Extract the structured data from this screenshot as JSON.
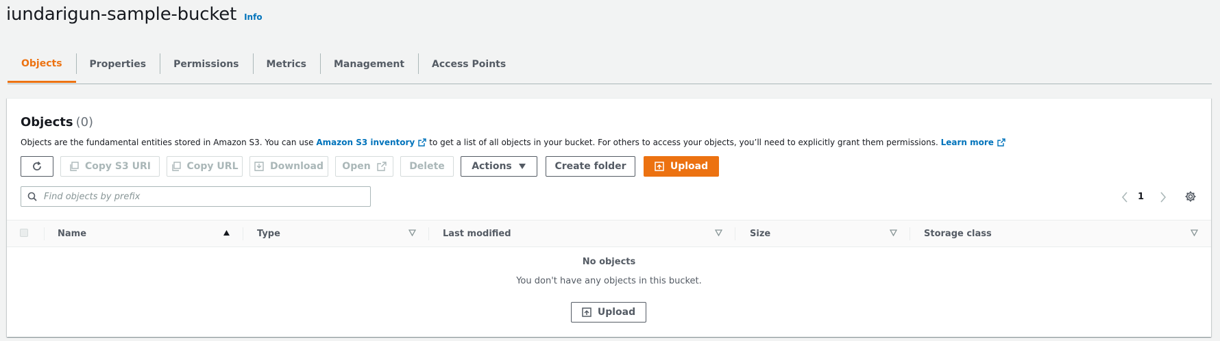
{
  "header": {
    "title": "iundarigun-sample-bucket",
    "info_label": "Info"
  },
  "tabs": [
    {
      "label": "Objects",
      "active": true
    },
    {
      "label": "Properties"
    },
    {
      "label": "Permissions"
    },
    {
      "label": "Metrics"
    },
    {
      "label": "Management"
    },
    {
      "label": "Access Points"
    }
  ],
  "objects": {
    "heading": "Objects",
    "count": "(0)",
    "desc_part1": "Objects are the fundamental entities stored in Amazon S3. You can use",
    "inventory_link": "Amazon S3 inventory",
    "desc_part2": "to get a list of all objects in your bucket. For others to access your objects, you’ll need to explicitly grant them permissions.",
    "learn_more": "Learn more"
  },
  "toolbar": {
    "copy_s3_uri": "Copy S3 URI",
    "copy_url": "Copy URL",
    "download": "Download",
    "open": "Open",
    "delete": "Delete",
    "actions": "Actions",
    "create_folder": "Create folder",
    "upload": "Upload"
  },
  "search": {
    "placeholder": "Find objects by prefix"
  },
  "pagination": {
    "page": "1"
  },
  "table": {
    "columns": [
      "Name",
      "Type",
      "Last modified",
      "Size",
      "Storage class"
    ],
    "empty_title": "No objects",
    "empty_desc": "You don't have any objects in this bucket.",
    "empty_upload": "Upload"
  },
  "colors": {
    "accent": "#ec7211",
    "link": "#0073bb",
    "text": "#16191f",
    "muted": "#545b64"
  }
}
